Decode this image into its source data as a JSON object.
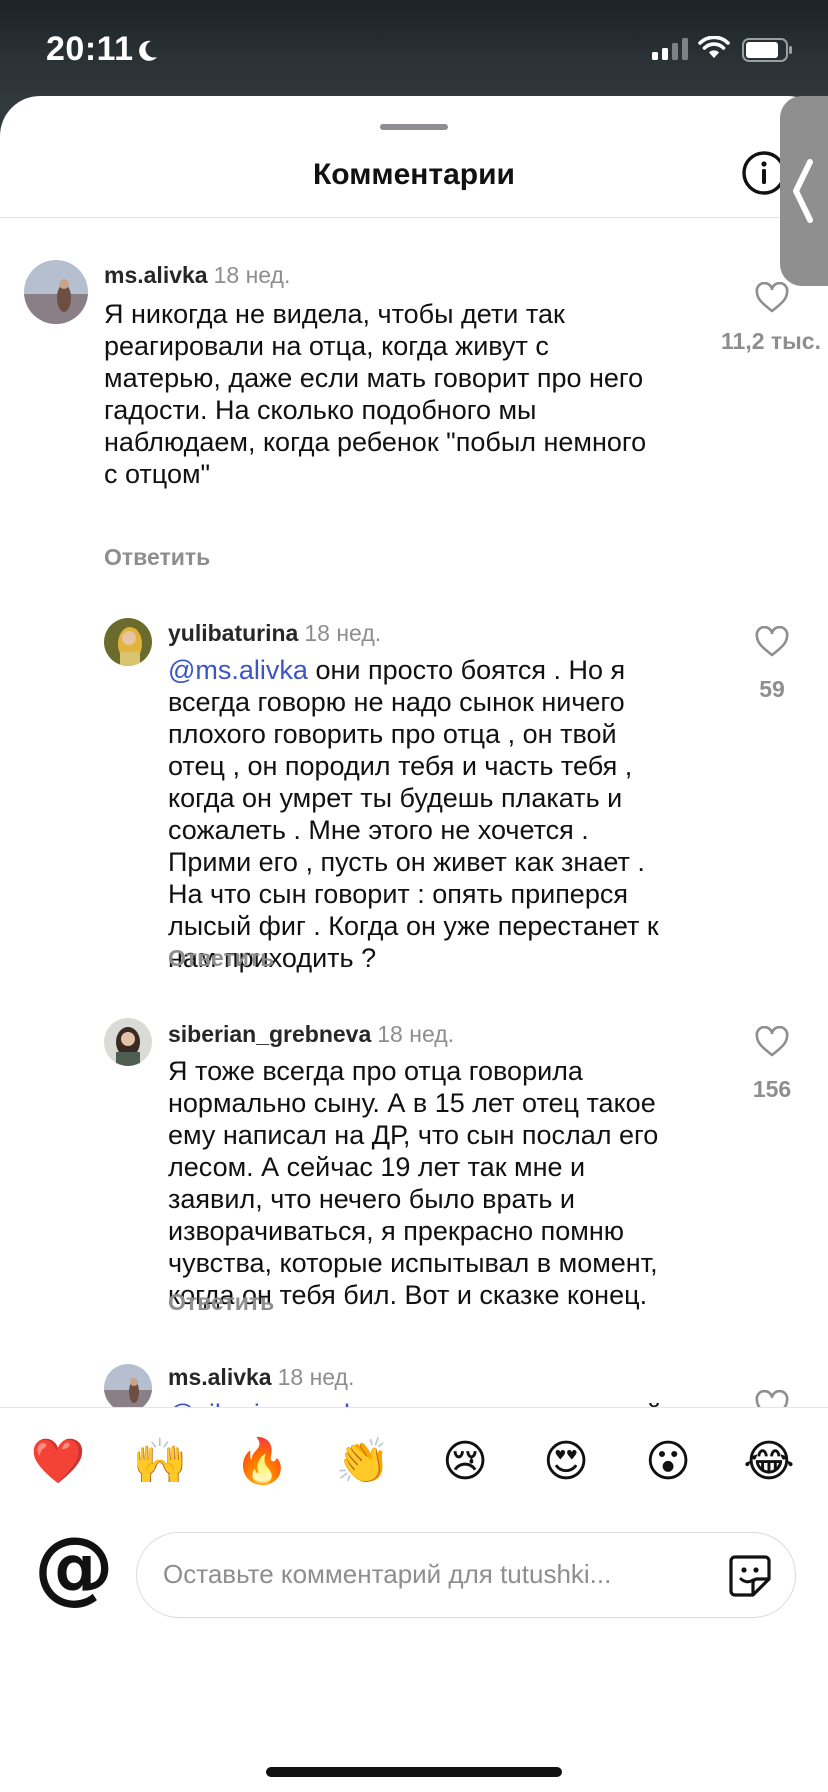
{
  "status_bar": {
    "time": "20:11"
  },
  "sheet": {
    "title": "Комментарии"
  },
  "comments": [
    {
      "user": "ms.alivka",
      "time": "18 нед.",
      "text": "Я никогда не видела, чтобы дети так\nреагировали на отца, когда живут с\nматерью, даже если мать говорит про него\nгадости. На сколько подобного мы\nнаблюдаем, когда ребенок \"побыл немного\nс отцом\"",
      "reply_label": "Ответить",
      "likes": "11,2 тыс."
    },
    {
      "user": "yulibaturina",
      "time": "18 нед.",
      "mention": "@ms.alivka",
      "text": " они просто боятся . Но я\nвсегда говорю не надо сынок ничего\nплохого говорить про отца , он твой\nотец , он породил тебя и часть тебя ,\nкогда он умрет ты будешь плакать и\nсожалеть . Мне этого не хочется .\nПрими его , пусть он живет как знает .\nНа что сын говорит : опять приперся\nлысый фиг . Когда он уже перестанет к\nнам приходить ?",
      "reply_label": "Ответить",
      "likes": "59"
    },
    {
      "user": "siberian_grebneva",
      "time": "18 нед.",
      "text": "Я тоже всегда про отца говорила\nнормально сыну. А в 15 лет отец такое\nему написал на ДР, что сын послал его\nлесом. А сейчас 19 лет так мне и\nзаявил, что нечего было врать и\nизворачиваться, я прекрасно помню\nчувства, которые испытывал в момент,\nкогда он тебя бил. Вот и сказке конец.",
      "reply_label": "Ответить",
      "likes": "156"
    },
    {
      "user": "ms.alivka",
      "time": "18 нед.",
      "mention": "@siberian_grebneva",
      "text": " ну выводы каждый"
    }
  ],
  "emoji_bar": [
    "❤️",
    "🙌",
    "🔥",
    "👏",
    "😢",
    "😍",
    "😮",
    "😂"
  ],
  "composer": {
    "placeholder": "Оставьте комментарий для tutushki..."
  },
  "colors": {
    "mention": "#3b55c6",
    "secondary_text": "#8e8e8e"
  }
}
